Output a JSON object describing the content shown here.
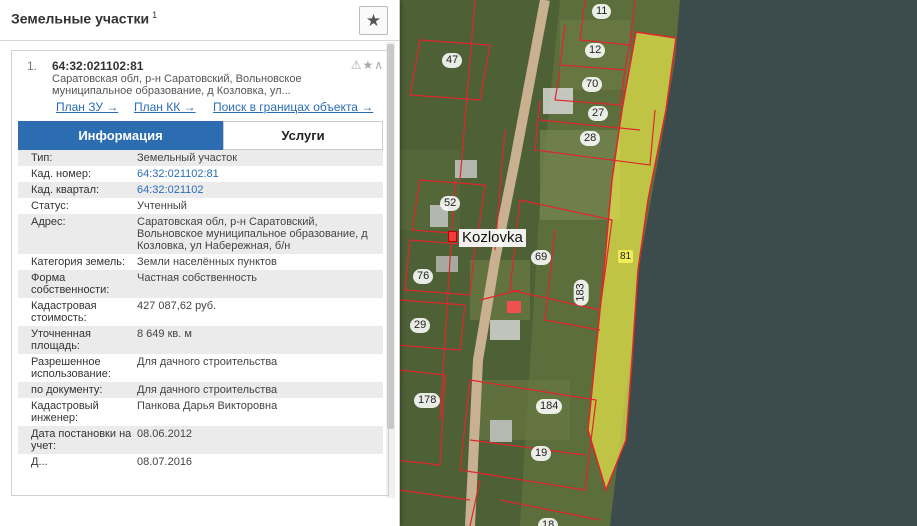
{
  "panel": {
    "title": "Земельные участки",
    "title_count": "1",
    "favorite_icon": "star-icon"
  },
  "result": {
    "number": "1.",
    "cad_number": "64:32:021102:81",
    "address_short": "Саратовская обл, р-н Саратовский, Вольновское муниципальное образование, д Козловка, ул...",
    "status_icons": "⚠★∧",
    "links": {
      "plan_zu": "План ЗУ →",
      "plan_kk": "План КК →",
      "search": "Поиск в границах объекта →"
    },
    "tabs": {
      "info": "Информация",
      "services": "Услуги"
    },
    "info": [
      {
        "key": "Тип:",
        "value": "Земельный участок",
        "link": false
      },
      {
        "key": "Кад. номер:",
        "value": "64:32:021102:81",
        "link": true
      },
      {
        "key": "Кад. квартал:",
        "value": "64:32:021102",
        "link": true
      },
      {
        "key": "Статус:",
        "value": "Учтенный",
        "link": false
      },
      {
        "key": "Адрес:",
        "value": "Саратовская обл, р-н Саратовский, Вольновское муниципальное образование, д Козловка, ул Набережная, б/н",
        "link": false
      },
      {
        "key": "Категория земель:",
        "value": "Земли населённых пунктов",
        "link": false
      },
      {
        "key": "Форма собственности:",
        "value": "Частная собственность",
        "link": false
      },
      {
        "key": "Кадастровая стоимость:",
        "value": "427 087,62 руб.",
        "link": false
      },
      {
        "key": "Уточненная площадь:",
        "value": "8 649 кв. м",
        "link": false
      },
      {
        "key": "Разрешенное использование:",
        "value": "Для дачного строительства",
        "link": false
      },
      {
        "key": "по документу:",
        "value": "Для дачного строительства",
        "link": false
      },
      {
        "key": "Кадастровый инженер:",
        "value": "Панкова Дарья Викторовна",
        "link": false
      },
      {
        "key": "Дата постановки на учет:",
        "value": "08.06.2012",
        "link": false
      },
      {
        "key": "Д...",
        "value": "08.07.2016",
        "link": false
      }
    ]
  },
  "map": {
    "village": "Kozlovka",
    "parcels": [
      "11",
      "12",
      "47",
      "70",
      "27",
      "28",
      "81",
      "52",
      "69",
      "76",
      "183",
      "29",
      "178",
      "184",
      "19",
      "18"
    ]
  },
  "colors": {
    "accent": "#2b6db0",
    "parcel_highlight": "#e8e64a",
    "parcel_border": "#e0262d",
    "water": "#3b4a4a"
  }
}
